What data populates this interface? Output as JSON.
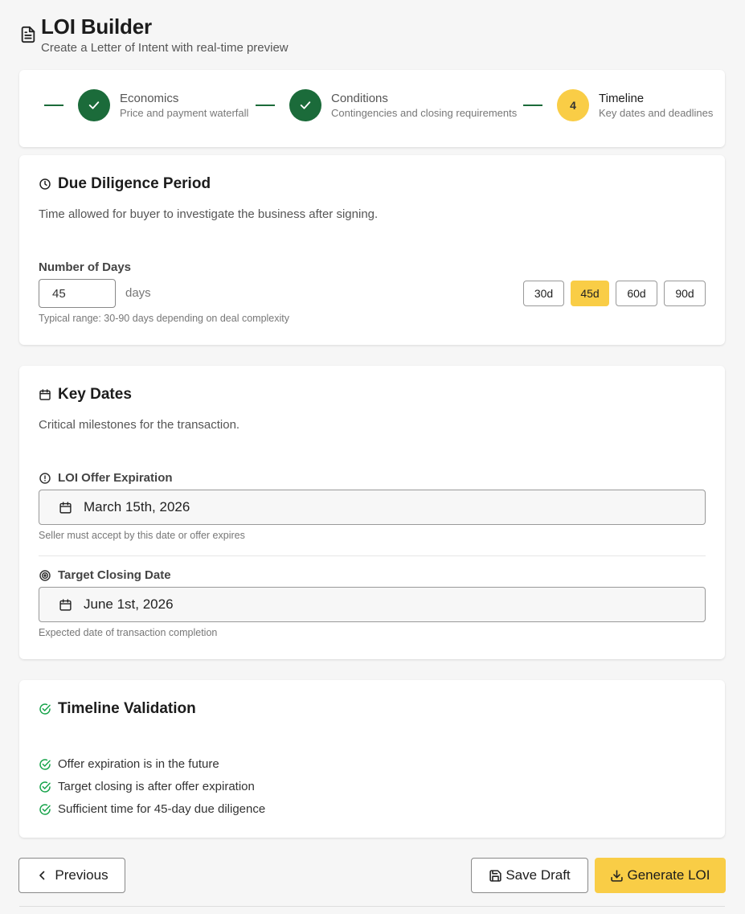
{
  "header": {
    "title": "LOI Builder",
    "subtitle": "Create a Letter of Intent with real-time preview"
  },
  "stepper": {
    "steps": [
      {
        "title": "Economics",
        "subtitle": "Price and payment waterfall",
        "state": "done"
      },
      {
        "title": "Conditions",
        "subtitle": "Contingencies and closing requirements",
        "state": "done"
      },
      {
        "title": "Timeline",
        "subtitle": "Key dates and deadlines",
        "state": "current",
        "number": "4"
      }
    ]
  },
  "due_diligence": {
    "title": "Due Diligence Period",
    "description": "Time allowed for buyer to investigate the business after signing.",
    "days_label": "Number of Days",
    "days_value": "45",
    "days_unit": "days",
    "hint": "Typical range: 30-90 days depending on deal complexity",
    "presets": [
      {
        "label": "30d",
        "selected": false
      },
      {
        "label": "45d",
        "selected": true
      },
      {
        "label": "60d",
        "selected": false
      },
      {
        "label": "90d",
        "selected": false
      }
    ]
  },
  "key_dates": {
    "title": "Key Dates",
    "description": "Critical milestones for the transaction.",
    "offer_expiration": {
      "label": "LOI Offer Expiration",
      "value": "March 15th, 2026",
      "hint": "Seller must accept by this date or offer expires"
    },
    "target_closing": {
      "label": "Target Closing Date",
      "value": "June 1st, 2026",
      "hint": "Expected date of transaction completion"
    }
  },
  "validation": {
    "title": "Timeline Validation",
    "checks": [
      "Offer expiration is in the future",
      "Target closing is after offer expiration",
      "Sufficient time for 45-day due diligence"
    ]
  },
  "actions": {
    "previous": "Previous",
    "save_draft": "Save Draft",
    "generate": "Generate LOI"
  },
  "colors": {
    "accent": "#f9cd46",
    "success": "#1b6b3a",
    "validation_green": "#16a34a"
  }
}
